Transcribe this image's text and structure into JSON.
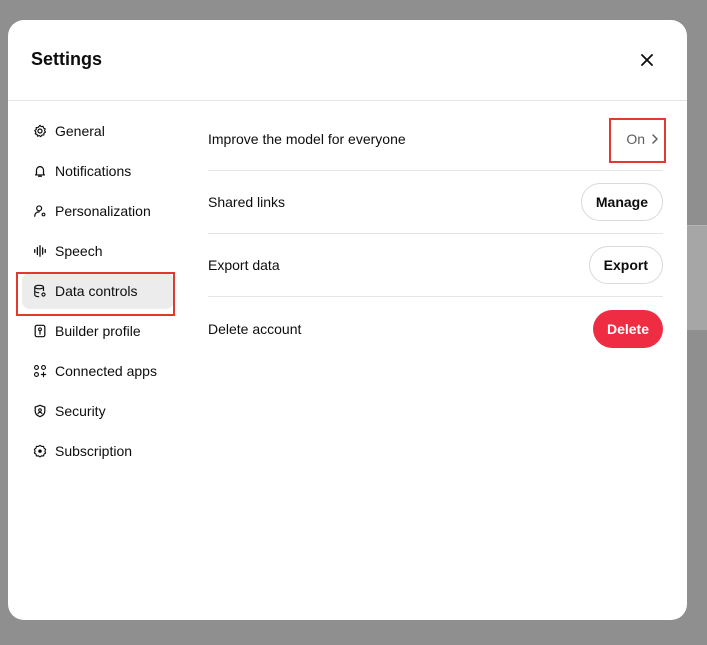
{
  "dialog": {
    "title": "Settings"
  },
  "sidebar": {
    "items": [
      {
        "label": "General",
        "icon": "gear-icon"
      },
      {
        "label": "Notifications",
        "icon": "bell-icon"
      },
      {
        "label": "Personalization",
        "icon": "person-icon"
      },
      {
        "label": "Speech",
        "icon": "waveform-icon"
      },
      {
        "label": "Data controls",
        "icon": "database-gear-icon",
        "active": true
      },
      {
        "label": "Builder profile",
        "icon": "id-card-icon"
      },
      {
        "label": "Connected apps",
        "icon": "apps-grid-icon"
      },
      {
        "label": "Security",
        "icon": "shield-icon"
      },
      {
        "label": "Subscription",
        "icon": "badge-icon"
      }
    ]
  },
  "data_controls": {
    "improve_model": {
      "label": "Improve the model for everyone",
      "value": "On"
    },
    "shared_links": {
      "label": "Shared links",
      "button": "Manage"
    },
    "export_data": {
      "label": "Export data",
      "button": "Export"
    },
    "delete_account": {
      "label": "Delete account",
      "button": "Delete"
    }
  },
  "colors": {
    "highlight": "#e03a2e",
    "danger": "#ef2d42",
    "active_bg": "#ececec"
  }
}
